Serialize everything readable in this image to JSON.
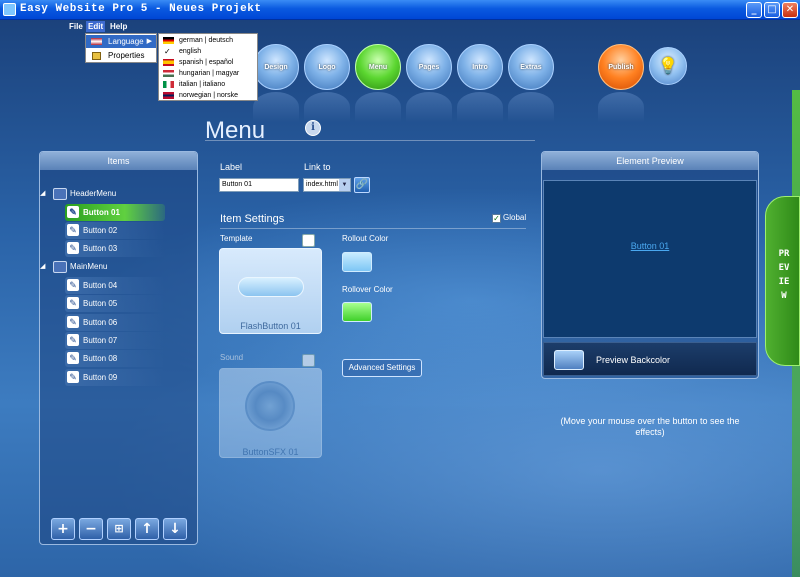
{
  "window": {
    "title": "Easy Website Pro 5 - Neues Projekt",
    "controls": {
      "minimize": "_",
      "maximize": "□",
      "close": "✕"
    }
  },
  "menubar": {
    "file": "File",
    "edit": "Edit",
    "help": "Help"
  },
  "edit_menu": {
    "language": "Language",
    "properties": "Properties"
  },
  "language_menu": [
    {
      "label": "german | deutsch",
      "flag": "de"
    },
    {
      "label": "english",
      "flag": "en",
      "checked": true
    },
    {
      "label": "spanish | español",
      "flag": "es"
    },
    {
      "label": "hungarian | magyar",
      "flag": "hu"
    },
    {
      "label": "italian | italiano",
      "flag": "it"
    },
    {
      "label": "norwegian | norske",
      "flag": "no"
    }
  ],
  "nav": {
    "design": "Design",
    "logo": "Logo",
    "menu": "Menu",
    "pages": "Pages",
    "intro": "Intro",
    "extras": "Extras",
    "publish": "Publish",
    "bulb_icon": "lightbulb-icon"
  },
  "page": {
    "title": "Menu",
    "info_icon": "i"
  },
  "items_panel": {
    "header": "Items",
    "groups": [
      {
        "name": "HeaderMenu",
        "items": [
          "Button 01",
          "Button 02",
          "Button 03"
        ]
      },
      {
        "name": "MainMenu",
        "items": [
          "Button 04",
          "Button 05",
          "Button 06",
          "Button 07",
          "Button 08",
          "Button 09"
        ]
      }
    ],
    "selected": "Button 01",
    "toolbar": {
      "add": "+",
      "remove": "−",
      "tree": "⊞",
      "up": "↑",
      "down": "↓"
    }
  },
  "form": {
    "label_caption": "Label",
    "label_value": "Button 01",
    "link_caption": "Link to",
    "link_value": "index.html",
    "item_settings": "Item Settings",
    "global_label": "Global",
    "global_checked": true,
    "template_label": "Template",
    "template_name": "FlashButton 01",
    "rollout_color_label": "Rollout Color",
    "rollout_color": "#7ec6f5",
    "rollover_color_label": "Rollover Color",
    "rollover_color": "#3fd02a",
    "sound_label": "Sound",
    "sound_name": "ButtonSFX 01",
    "advanced_settings": "Advanced Settings"
  },
  "preview": {
    "header": "Element Preview",
    "link_text": "Button 01",
    "backcolor_label": "Preview Backcolor",
    "hint": "(Move your mouse over the button to see the effects)",
    "side_tab": "PREVIEW"
  }
}
